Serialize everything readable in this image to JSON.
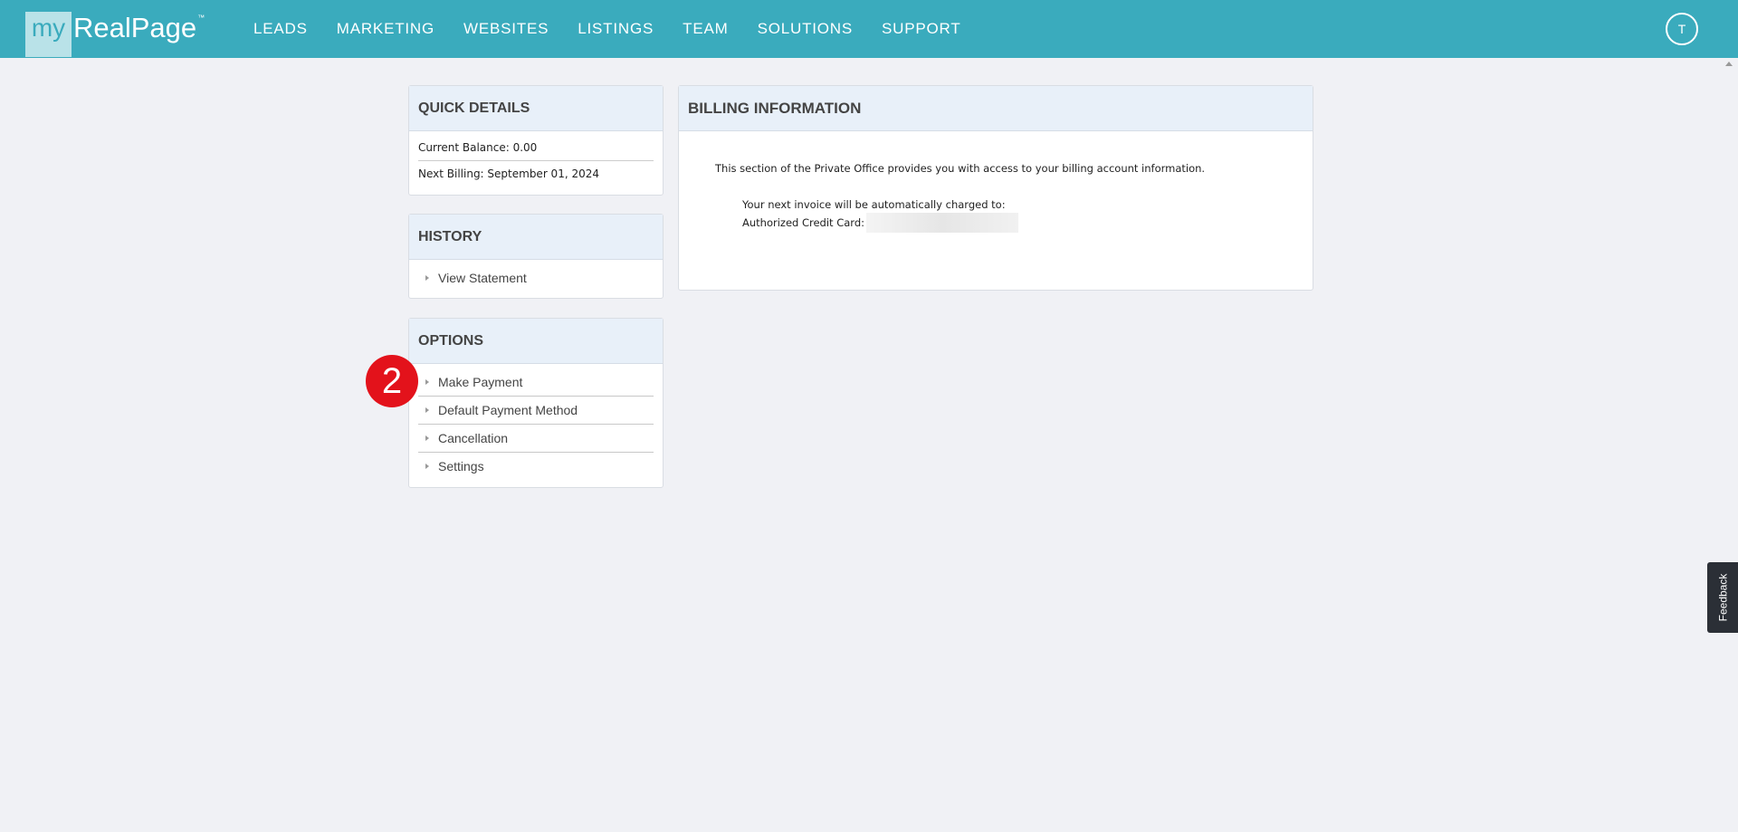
{
  "brand": {
    "logo_my": "my",
    "logo_name": "RealPage",
    "logo_tm": "™"
  },
  "nav": {
    "items": [
      {
        "label": "LEADS"
      },
      {
        "label": "MARKETING"
      },
      {
        "label": "WEBSITES"
      },
      {
        "label": "LISTINGS"
      },
      {
        "label": "TEAM"
      },
      {
        "label": "SOLUTIONS"
      },
      {
        "label": "SUPPORT"
      }
    ],
    "avatar_initial": "T"
  },
  "quick_details": {
    "title": "QUICK DETAILS",
    "current_balance": "Current Balance: 0.00",
    "next_billing": "Next Billing: September 01, 2024"
  },
  "history": {
    "title": "HISTORY",
    "items": [
      {
        "label": "View Statement"
      }
    ]
  },
  "options": {
    "title": "OPTIONS",
    "items": [
      {
        "label": "Make Payment"
      },
      {
        "label": "Default Payment Method"
      },
      {
        "label": "Cancellation"
      },
      {
        "label": "Settings"
      }
    ]
  },
  "billing": {
    "title": "BILLING INFORMATION",
    "intro": "This section of the Private Office provides you with access to your billing account information.",
    "next_invoice": "Your next invoice will be automatically charged to:",
    "card_label": "Authorized Credit Card:"
  },
  "annotation": {
    "step": "2",
    "color": "#e3121b"
  },
  "feedback": {
    "label": "Feedback"
  },
  "colors": {
    "header": "#3aabbd",
    "panel_head": "#e8f0f9",
    "background": "#f0f1f5"
  }
}
